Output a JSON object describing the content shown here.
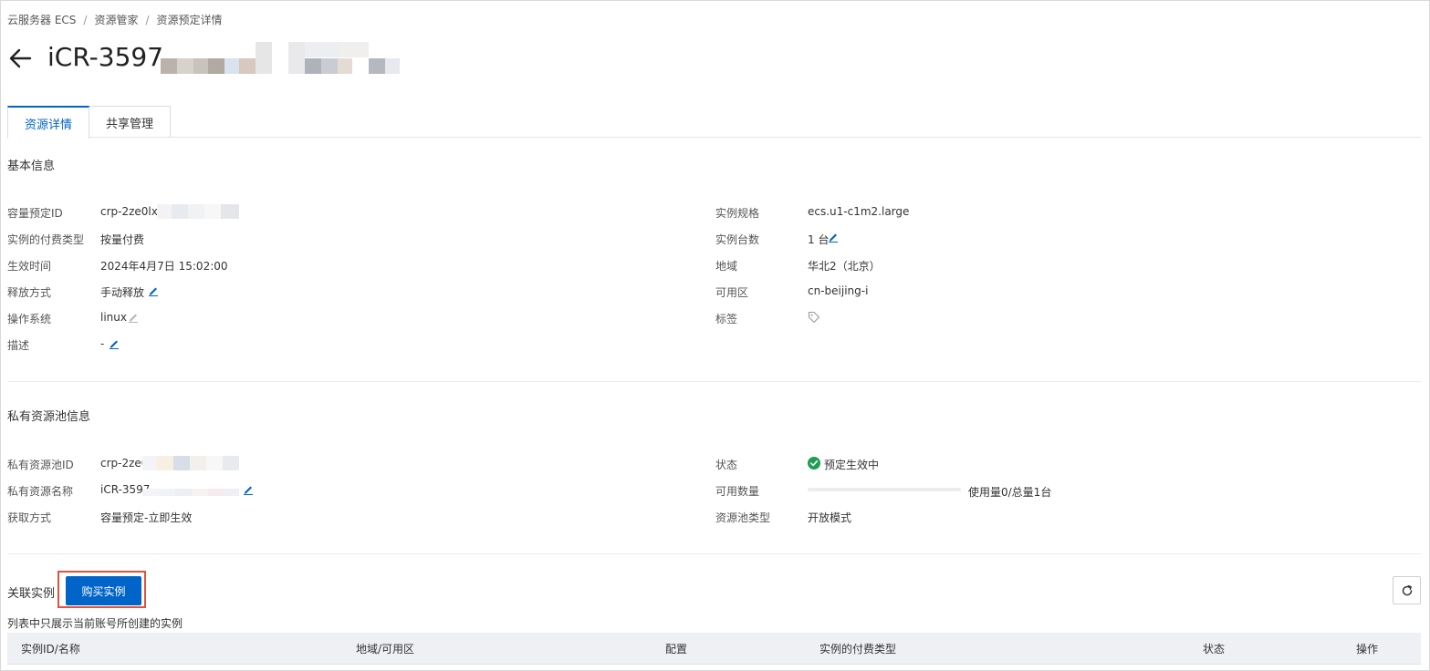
{
  "breadcrumb": [
    "云服务器 ECS",
    "资源管家",
    "资源预定详情"
  ],
  "header": {
    "title": "iCR-3597"
  },
  "tabs": [
    {
      "label": "资源详情",
      "active": true
    },
    {
      "label": "共享管理",
      "active": false
    }
  ],
  "basic": {
    "title": "基本信息",
    "left": [
      {
        "label": "容量预定ID",
        "value": "crp-2ze0lxk"
      },
      {
        "label": "实例的付费类型",
        "value": "按量付费"
      },
      {
        "label": "生效时间",
        "value": " 2024年4月7日 15:02:00"
      },
      {
        "label": "释放方式",
        "value": "手动释放"
      },
      {
        "label": "操作系统",
        "value": "linux"
      },
      {
        "label": "描述",
        "value": "-"
      }
    ],
    "right": [
      {
        "label": "实例规格",
        "value": "ecs.u1-c1m2.large"
      },
      {
        "label": "实例台数",
        "value": "1 台"
      },
      {
        "label": "地域",
        "value": "华北2（北京）"
      },
      {
        "label": "可用区",
        "value": "cn-beijing-i"
      },
      {
        "label": "标签",
        "value": ""
      }
    ]
  },
  "pool": {
    "title": "私有资源池信息",
    "left": [
      {
        "label": "私有资源池ID",
        "value": "crp-2ze0"
      },
      {
        "label": "私有资源名称",
        "value": "iCR-3597"
      },
      {
        "label": "获取方式",
        "value": "容量预定-立即生效"
      }
    ],
    "right": [
      {
        "label": "状态",
        "value": "预定生效中"
      },
      {
        "label": "可用数量",
        "value": "使用量0/总量1台"
      },
      {
        "label": "资源池类型",
        "value": "开放模式"
      }
    ],
    "usage_fraction": 0
  },
  "instances": {
    "title": "关联实例",
    "buy_button": "购买实例",
    "note": "列表中只展示当前账号所创建的实例",
    "columns": [
      "实例ID/名称",
      "地域/可用区",
      "配置",
      "实例的付费类型",
      "状态",
      "操作"
    ]
  },
  "colors": {
    "accent": "#0064c8",
    "success": "#1f9d55",
    "highlight": "#e0533a"
  }
}
